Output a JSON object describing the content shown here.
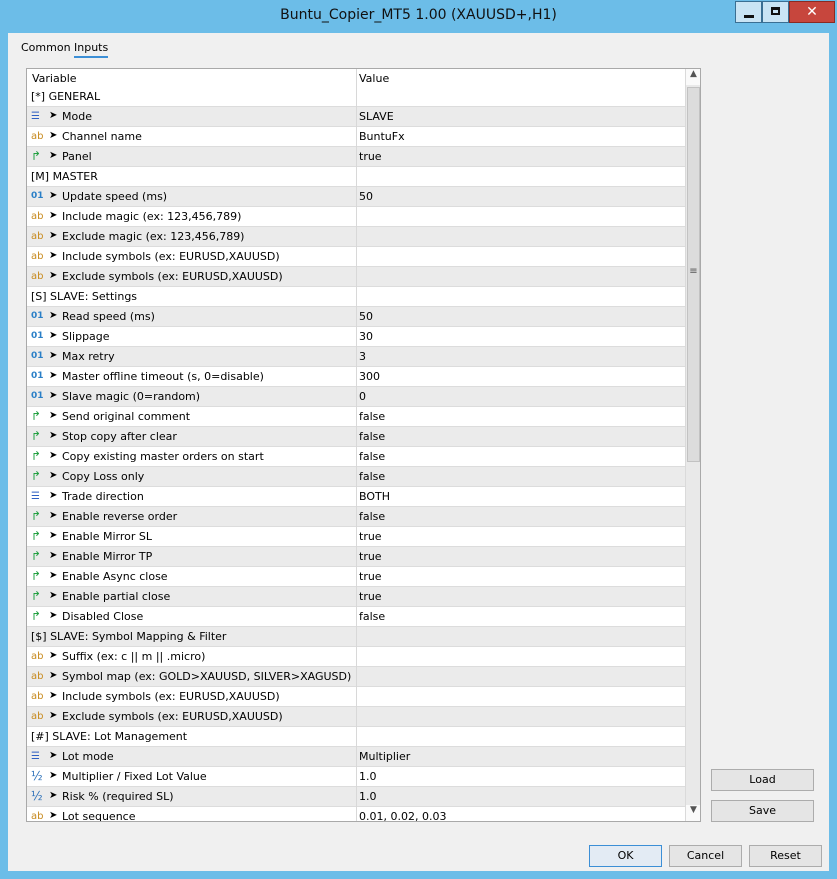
{
  "window": {
    "title": "Buntu_Copier_MT5 1.00 (XAUUSD+,H1)",
    "min_glyph": "",
    "max_glyph": "",
    "close_glyph": "✕",
    "accent_color": "#6cbde8",
    "close_color": "#c7463d"
  },
  "tabs": [
    {
      "label": "Common",
      "selected": false
    },
    {
      "label": "Inputs",
      "selected": true
    }
  ],
  "grid": {
    "header_variable": "Variable",
    "header_value": "Value",
    "rows": [
      {
        "section": true,
        "name": "[*] GENERAL",
        "value": ""
      },
      {
        "icon": "enum",
        "name": "Mode",
        "value": "SLAVE"
      },
      {
        "icon": "ab",
        "name": "Channel name",
        "value": "BuntuFx"
      },
      {
        "icon": "bool",
        "name": "Panel",
        "value": "true"
      },
      {
        "section": true,
        "name": "[M] MASTER",
        "value": ""
      },
      {
        "icon": "01",
        "name": "Update speed (ms)",
        "value": "50"
      },
      {
        "icon": "ab",
        "name": "Include magic (ex: 123,456,789)",
        "value": ""
      },
      {
        "icon": "ab",
        "name": "Exclude magic (ex: 123,456,789)",
        "value": ""
      },
      {
        "icon": "ab",
        "name": "Include symbols (ex: EURUSD,XAUUSD)",
        "value": ""
      },
      {
        "icon": "ab",
        "name": "Exclude symbols (ex: EURUSD,XAUUSD)",
        "value": ""
      },
      {
        "section": true,
        "name": "[S] SLAVE: Settings",
        "value": ""
      },
      {
        "icon": "01",
        "name": "Read speed (ms)",
        "value": "50"
      },
      {
        "icon": "01",
        "name": "Slippage",
        "value": "30"
      },
      {
        "icon": "01",
        "name": "Max retry",
        "value": "3"
      },
      {
        "icon": "01",
        "name": "Master offline timeout (s, 0=disable)",
        "value": "300"
      },
      {
        "icon": "01",
        "name": "Slave magic (0=random)",
        "value": "0"
      },
      {
        "icon": "bool",
        "name": "Send original comment",
        "value": "false"
      },
      {
        "icon": "bool",
        "name": "Stop copy after clear",
        "value": "false"
      },
      {
        "icon": "bool",
        "name": "Copy existing master orders on start",
        "value": "false"
      },
      {
        "icon": "bool",
        "name": "Copy Loss only",
        "value": "false"
      },
      {
        "icon": "enum",
        "name": "Trade direction",
        "value": "BOTH"
      },
      {
        "icon": "bool",
        "name": "Enable reverse order",
        "value": "false"
      },
      {
        "icon": "bool",
        "name": "Enable Mirror SL",
        "value": "true"
      },
      {
        "icon": "bool",
        "name": "Enable Mirror TP",
        "value": "true"
      },
      {
        "icon": "bool",
        "name": "Enable Async close",
        "value": "true"
      },
      {
        "icon": "bool",
        "name": "Enable partial close",
        "value": "true"
      },
      {
        "icon": "bool",
        "name": "Disabled Close",
        "value": "false"
      },
      {
        "section": true,
        "name": "[$] SLAVE: Symbol Mapping & Filter",
        "value": ""
      },
      {
        "icon": "ab",
        "name": "Suffix (ex: c || m || .micro)",
        "value": ""
      },
      {
        "icon": "ab",
        "name": "Symbol map (ex: GOLD>XAUUSD, SILVER>XAGUSD)",
        "value": ""
      },
      {
        "icon": "ab",
        "name": "Include symbols (ex: EURUSD,XAUUSD)",
        "value": ""
      },
      {
        "icon": "ab",
        "name": "Exclude symbols (ex: EURUSD,XAUUSD)",
        "value": ""
      },
      {
        "section": true,
        "name": "[#] SLAVE: Lot Management",
        "value": ""
      },
      {
        "icon": "enum",
        "name": "Lot mode",
        "value": "Multiplier"
      },
      {
        "icon": "half",
        "name": "Multiplier / Fixed Lot Value",
        "value": "1.0"
      },
      {
        "icon": "half",
        "name": "Risk % (required SL)",
        "value": "1.0"
      },
      {
        "icon": "ab",
        "name": "Lot sequence",
        "value": "0.01, 0.02, 0.03"
      }
    ]
  },
  "icons": {
    "enum": "☰",
    "ab": "ab",
    "bool": "↱",
    "01": "01",
    "half": "½",
    "arrow": "➤"
  },
  "scrollbar": {
    "up": "▲",
    "down": "▼",
    "grip": "≡"
  },
  "buttons": {
    "load": "Load",
    "save": "Save",
    "ok": "OK",
    "cancel": "Cancel",
    "reset": "Reset"
  }
}
